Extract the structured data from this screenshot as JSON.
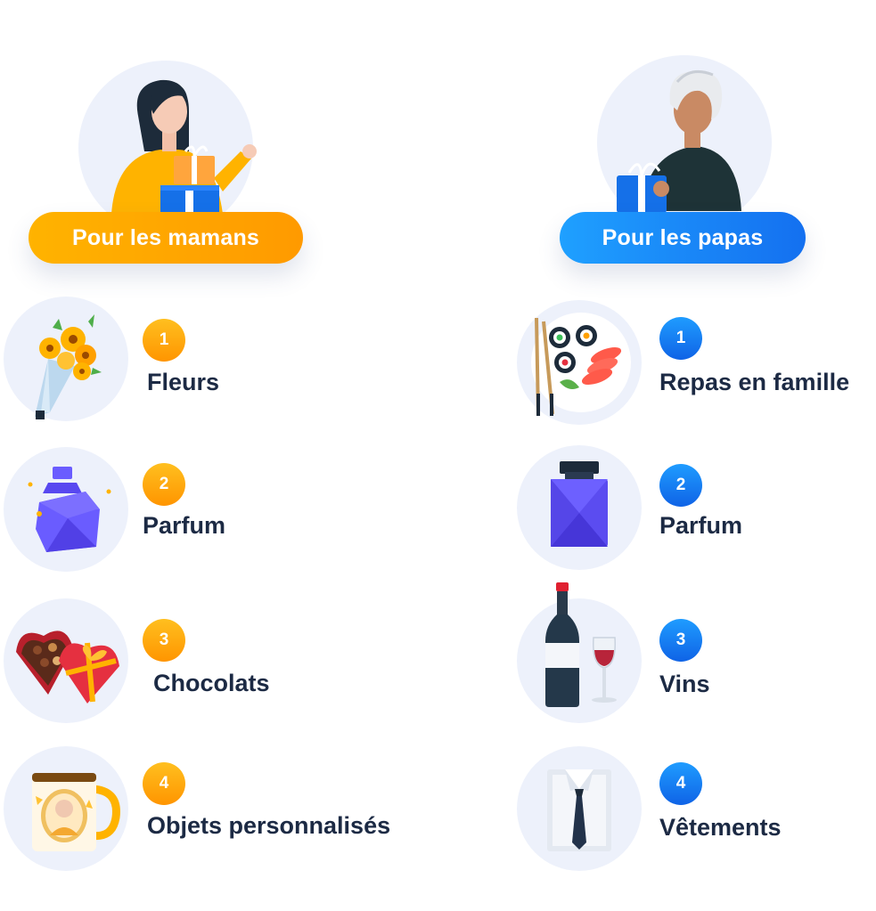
{
  "mamans": {
    "title": "Pour les mamans",
    "items": [
      {
        "rank": "1",
        "label": "Fleurs",
        "icon": "bouquet-icon"
      },
      {
        "rank": "2",
        "label": "Parfum",
        "icon": "perfume-bottle-icon"
      },
      {
        "rank": "3",
        "label": "Chocolats",
        "icon": "chocolate-box-icon"
      },
      {
        "rank": "4",
        "label": "Objets personnalisés",
        "icon": "photo-mug-icon"
      }
    ]
  },
  "papas": {
    "title": "Pour les papas",
    "items": [
      {
        "rank": "1",
        "label": "Repas en famille",
        "icon": "sushi-plate-icon"
      },
      {
        "rank": "2",
        "label": "Parfum",
        "icon": "cologne-bottle-icon"
      },
      {
        "rank": "3",
        "label": "Vins",
        "icon": "wine-icon"
      },
      {
        "rank": "4",
        "label": "Vêtements",
        "icon": "shirt-tie-icon"
      }
    ]
  },
  "colors": {
    "orange_accent": "#ff9e00",
    "blue_accent": "#1479f2",
    "text_dark": "#1c2a44",
    "circle_bg": "#edf1fb"
  }
}
